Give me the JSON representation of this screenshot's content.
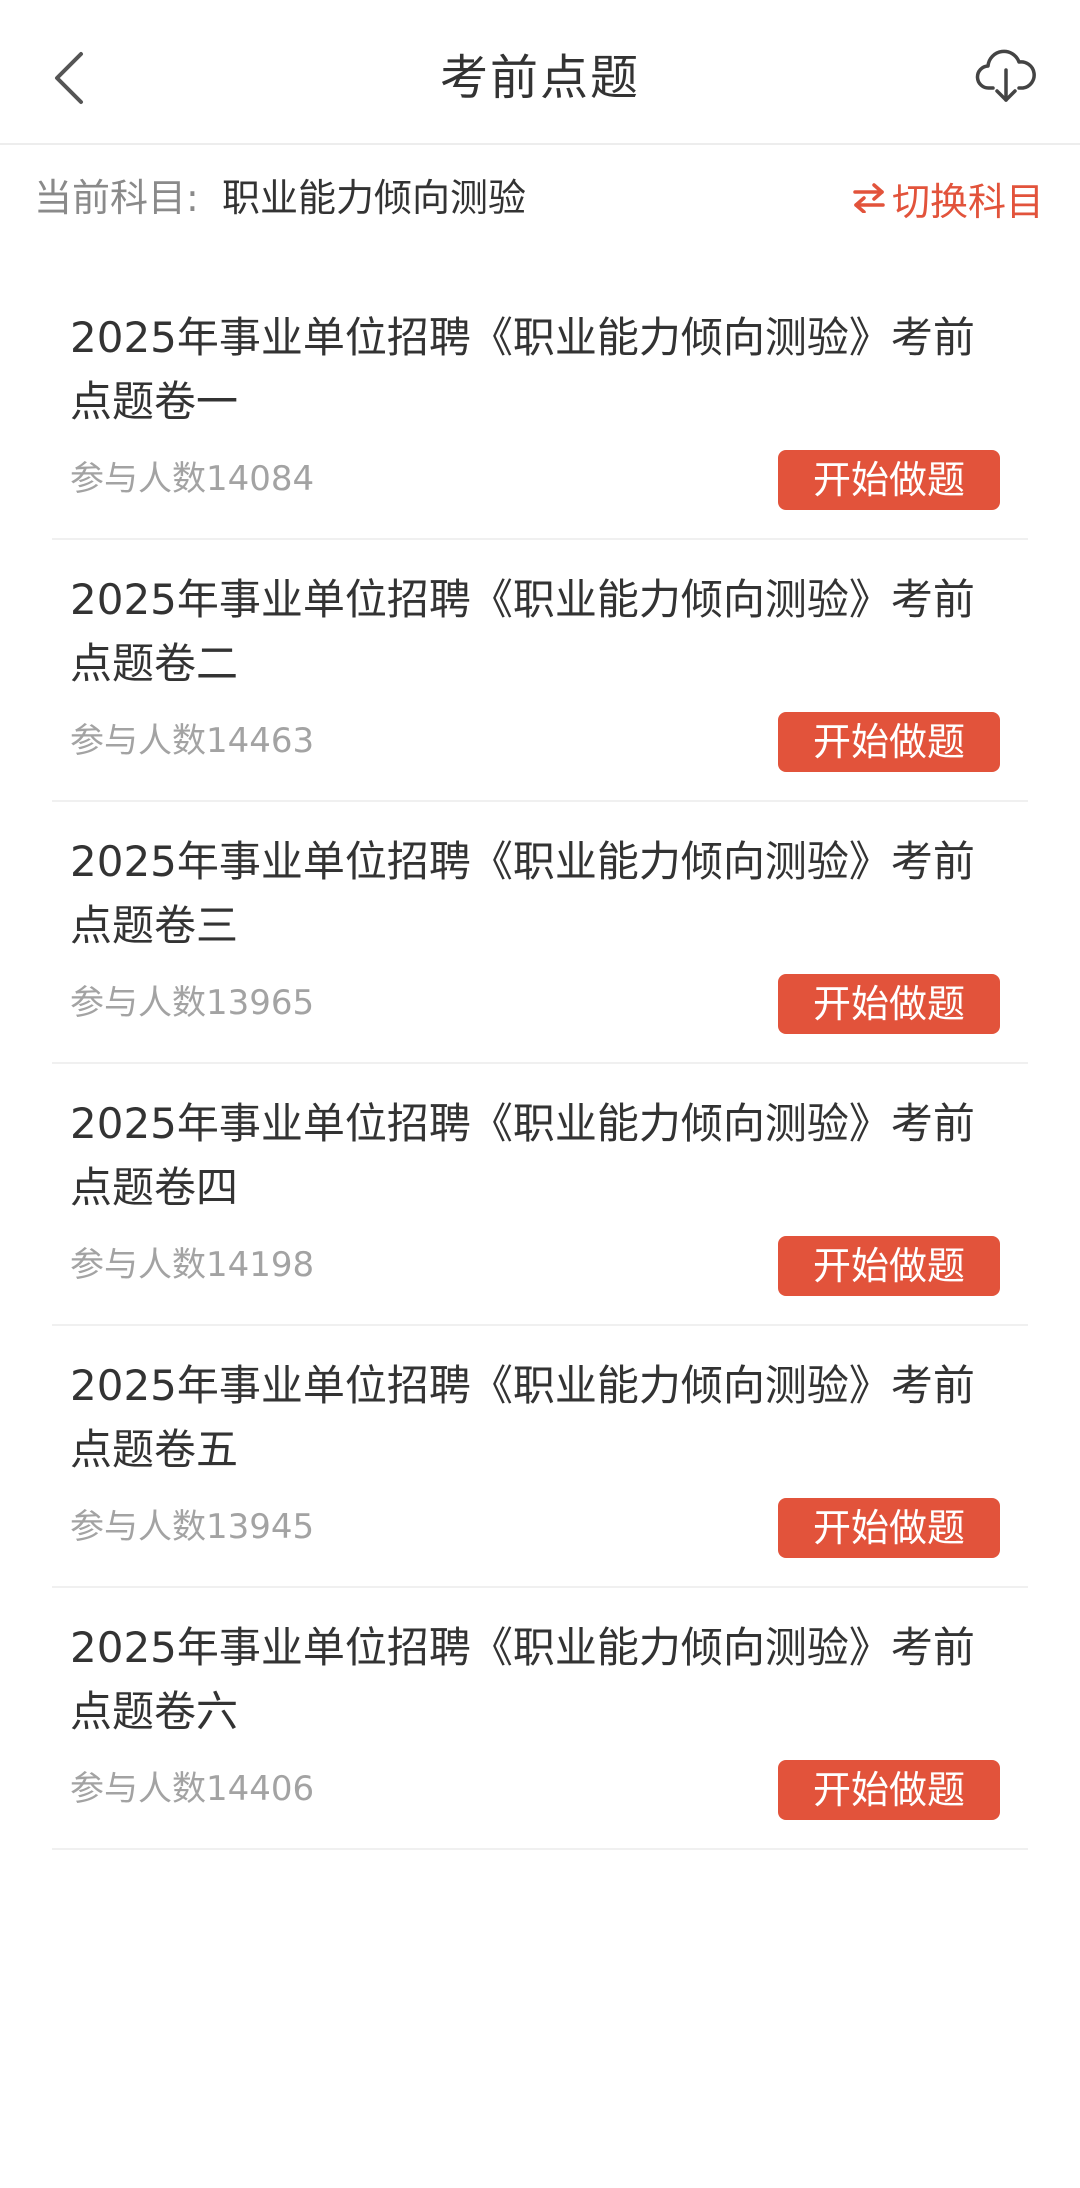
{
  "nav": {
    "title": "考前点题",
    "back_icon": "chevron-left-icon",
    "download_icon": "cloud-download-icon"
  },
  "subject": {
    "label": "当前科目:",
    "name": "职业能力倾向测验",
    "switch_label": "切换科目",
    "switch_icon": "swap-arrows-icon"
  },
  "accent_color": "#e2533b",
  "papers": [
    {
      "title": "2025年事业单位招聘《职业能力倾向测验》考前点题卷一",
      "count": "参与人数14084",
      "action": "开始做题"
    },
    {
      "title": "2025年事业单位招聘《职业能力倾向测验》考前点题卷二",
      "count": "参与人数14463",
      "action": "开始做题"
    },
    {
      "title": "2025年事业单位招聘《职业能力倾向测验》考前点题卷三",
      "count": "参与人数13965",
      "action": "开始做题"
    },
    {
      "title": "2025年事业单位招聘《职业能力倾向测验》考前点题卷四",
      "count": "参与人数14198",
      "action": "开始做题"
    },
    {
      "title": "2025年事业单位招聘《职业能力倾向测验》考前点题卷五",
      "count": "参与人数13945",
      "action": "开始做题"
    },
    {
      "title": "2025年事业单位招聘《职业能力倾向测验》考前点题卷六",
      "count": "参与人数14406",
      "action": "开始做题"
    }
  ]
}
